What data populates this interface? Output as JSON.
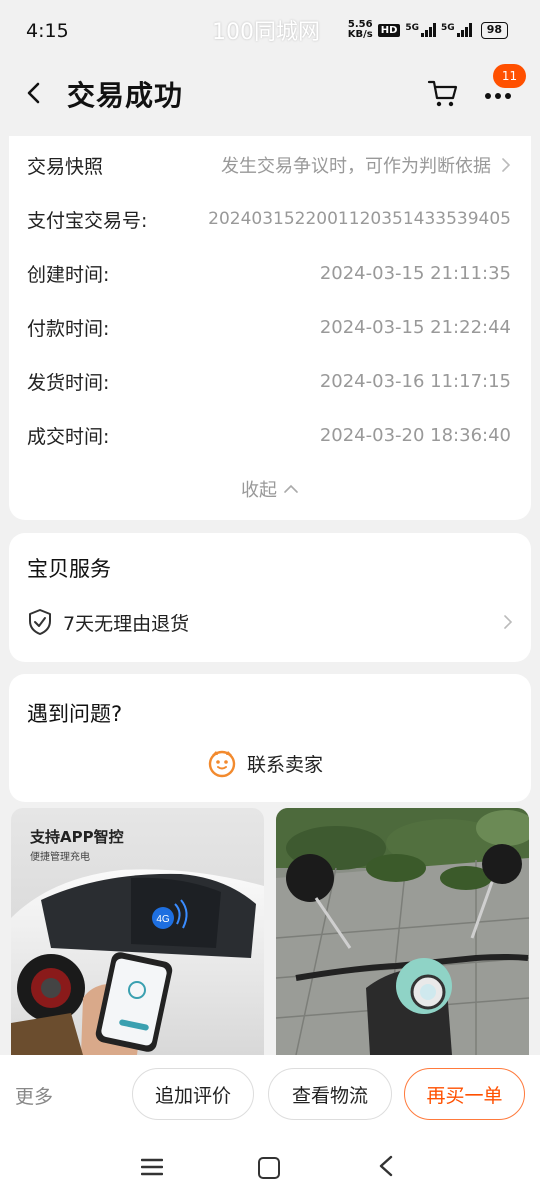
{
  "status_bar": {
    "time": "4:15",
    "watermark": "100同城网",
    "net_speed_value": "5.56",
    "net_speed_unit": "KB/s",
    "hd_label": "HD",
    "sig1_label": "5G",
    "sig2_label": "5G",
    "battery": "98"
  },
  "header": {
    "title": "交易成功",
    "cart_badge_count": "11"
  },
  "order_info": {
    "snapshot_label": "交易快照",
    "snapshot_hint": "发生交易争议时，可作为判断依据",
    "alipay_label": "支付宝交易号:",
    "alipay_value": "2024031522001120351433539405",
    "created_label": "创建时间:",
    "created_value": "2024-03-15 21:11:35",
    "paid_label": "付款时间:",
    "paid_value": "2024-03-15 21:22:44",
    "shipped_label": "发货时间:",
    "shipped_value": "2024-03-16 11:17:15",
    "completed_label": "成交时间:",
    "completed_value": "2024-03-20 18:36:40",
    "collapse_label": "收起"
  },
  "service": {
    "title": "宝贝服务",
    "return_policy": "7天无理由退货"
  },
  "help": {
    "title": "遇到问题?",
    "contact_seller": "联系卖家"
  },
  "products": {
    "left_title": "支持APP智控",
    "left_subtitle": "便捷管理充电",
    "left_badge": "4G"
  },
  "actions": {
    "more": "更多",
    "add_review": "追加评价",
    "view_logistics": "查看物流",
    "buy_again": "再买一单"
  },
  "colors": {
    "accent": "#ff5000",
    "accent_border": "#ff7a3c",
    "background": "#f1f1f1"
  },
  "icons": {
    "back": "chevron-left-icon",
    "cart": "cart-icon",
    "more": "more-dots-icon",
    "shield": "shield-check-icon",
    "seller": "seller-face-icon"
  }
}
